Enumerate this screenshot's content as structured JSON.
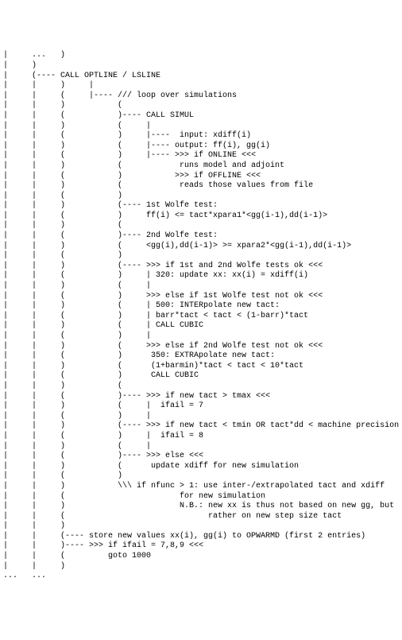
{
  "text": "|     ...   )\n|     )\n|     (---- CALL OPTLINE / LSLINE\n|     |     )     |\n|     |     (     |---- /// loop over simulations\n|     |     )           (\n|     |     (           )---- CALL SIMUL\n|     |     )           (     |\n|     |     (           )     |----  input: xdiff(i)\n|     |     )           (     |---- output: ff(i), gg(i)\n|     |     (           )     |---- >>> if ONLINE <<<\n|     |     )           (            runs model and adjoint\n|     |     (           )           >>> if OFFLINE <<<\n|     |     )           (            reads those values from file\n|     |     (           )\n|     |     )           (---- 1st Wolfe test:\n|     |     (           )     ff(i) <= tact*xpara1*<gg(i-1),dd(i-1)>\n|     |     )           (\n|     |     (           )---- 2nd Wolfe test:\n|     |     )           (     <gg(i),dd(i-1)> >= xpara2*<gg(i-1),dd(i-1)>\n|     |     (           )\n|     |     )           (---- >>> if 1st and 2nd Wolfe tests ok <<<\n|     |     (           )     | 320: update xx: xx(i) = xdiff(i)\n|     |     )           (     |\n|     |     (           )     >>> else if 1st Wolfe test not ok <<<\n|     |     )           (     | 500: INTERpolate new tact:\n|     |     (           )     | barr*tact < tact < (1-barr)*tact\n|     |     )           (     | CALL CUBIC\n|     |     (           )     |\n|     |     )           (     >>> else if 2nd Wolfe test not ok <<<\n|     |     (           )      350: EXTRApolate new tact:\n|     |     )           (      (1+barmin)*tact < tact < 10*tact\n|     |     (           )      CALL CUBIC\n|     |     )           (\n|     |     (           )---- >>> if new tact > tmax <<<\n|     |     )           (     |  ifail = 7\n|     |     (           )     |\n|     |     )           (---- >>> if new tact < tmin OR tact*dd < machine precision <<<\n|     |     (           )     |  ifail = 8\n|     |     )           (     |\n|     |     (           )---- >>> else <<<\n|     |     )           (      update xdiff for new simulation\n|     |     (           )\n|     |     )           \\\\\\ if nfunc > 1: use inter-/extrapolated tact and xdiff\n|     |     (                        for new simulation\n|     |     )                        N.B.: new xx is thus not based on new gg, but\n|     |     (                              rather on new step size tact\n|     |     )\n|     |     (---- store new values xx(i), gg(i) to OPWARMD (first 2 entries)\n|     |     )---- >>> if ifail = 7,8,9 <<<\n|     |     (         goto 1000\n|     |     )\n...   ...\n"
}
